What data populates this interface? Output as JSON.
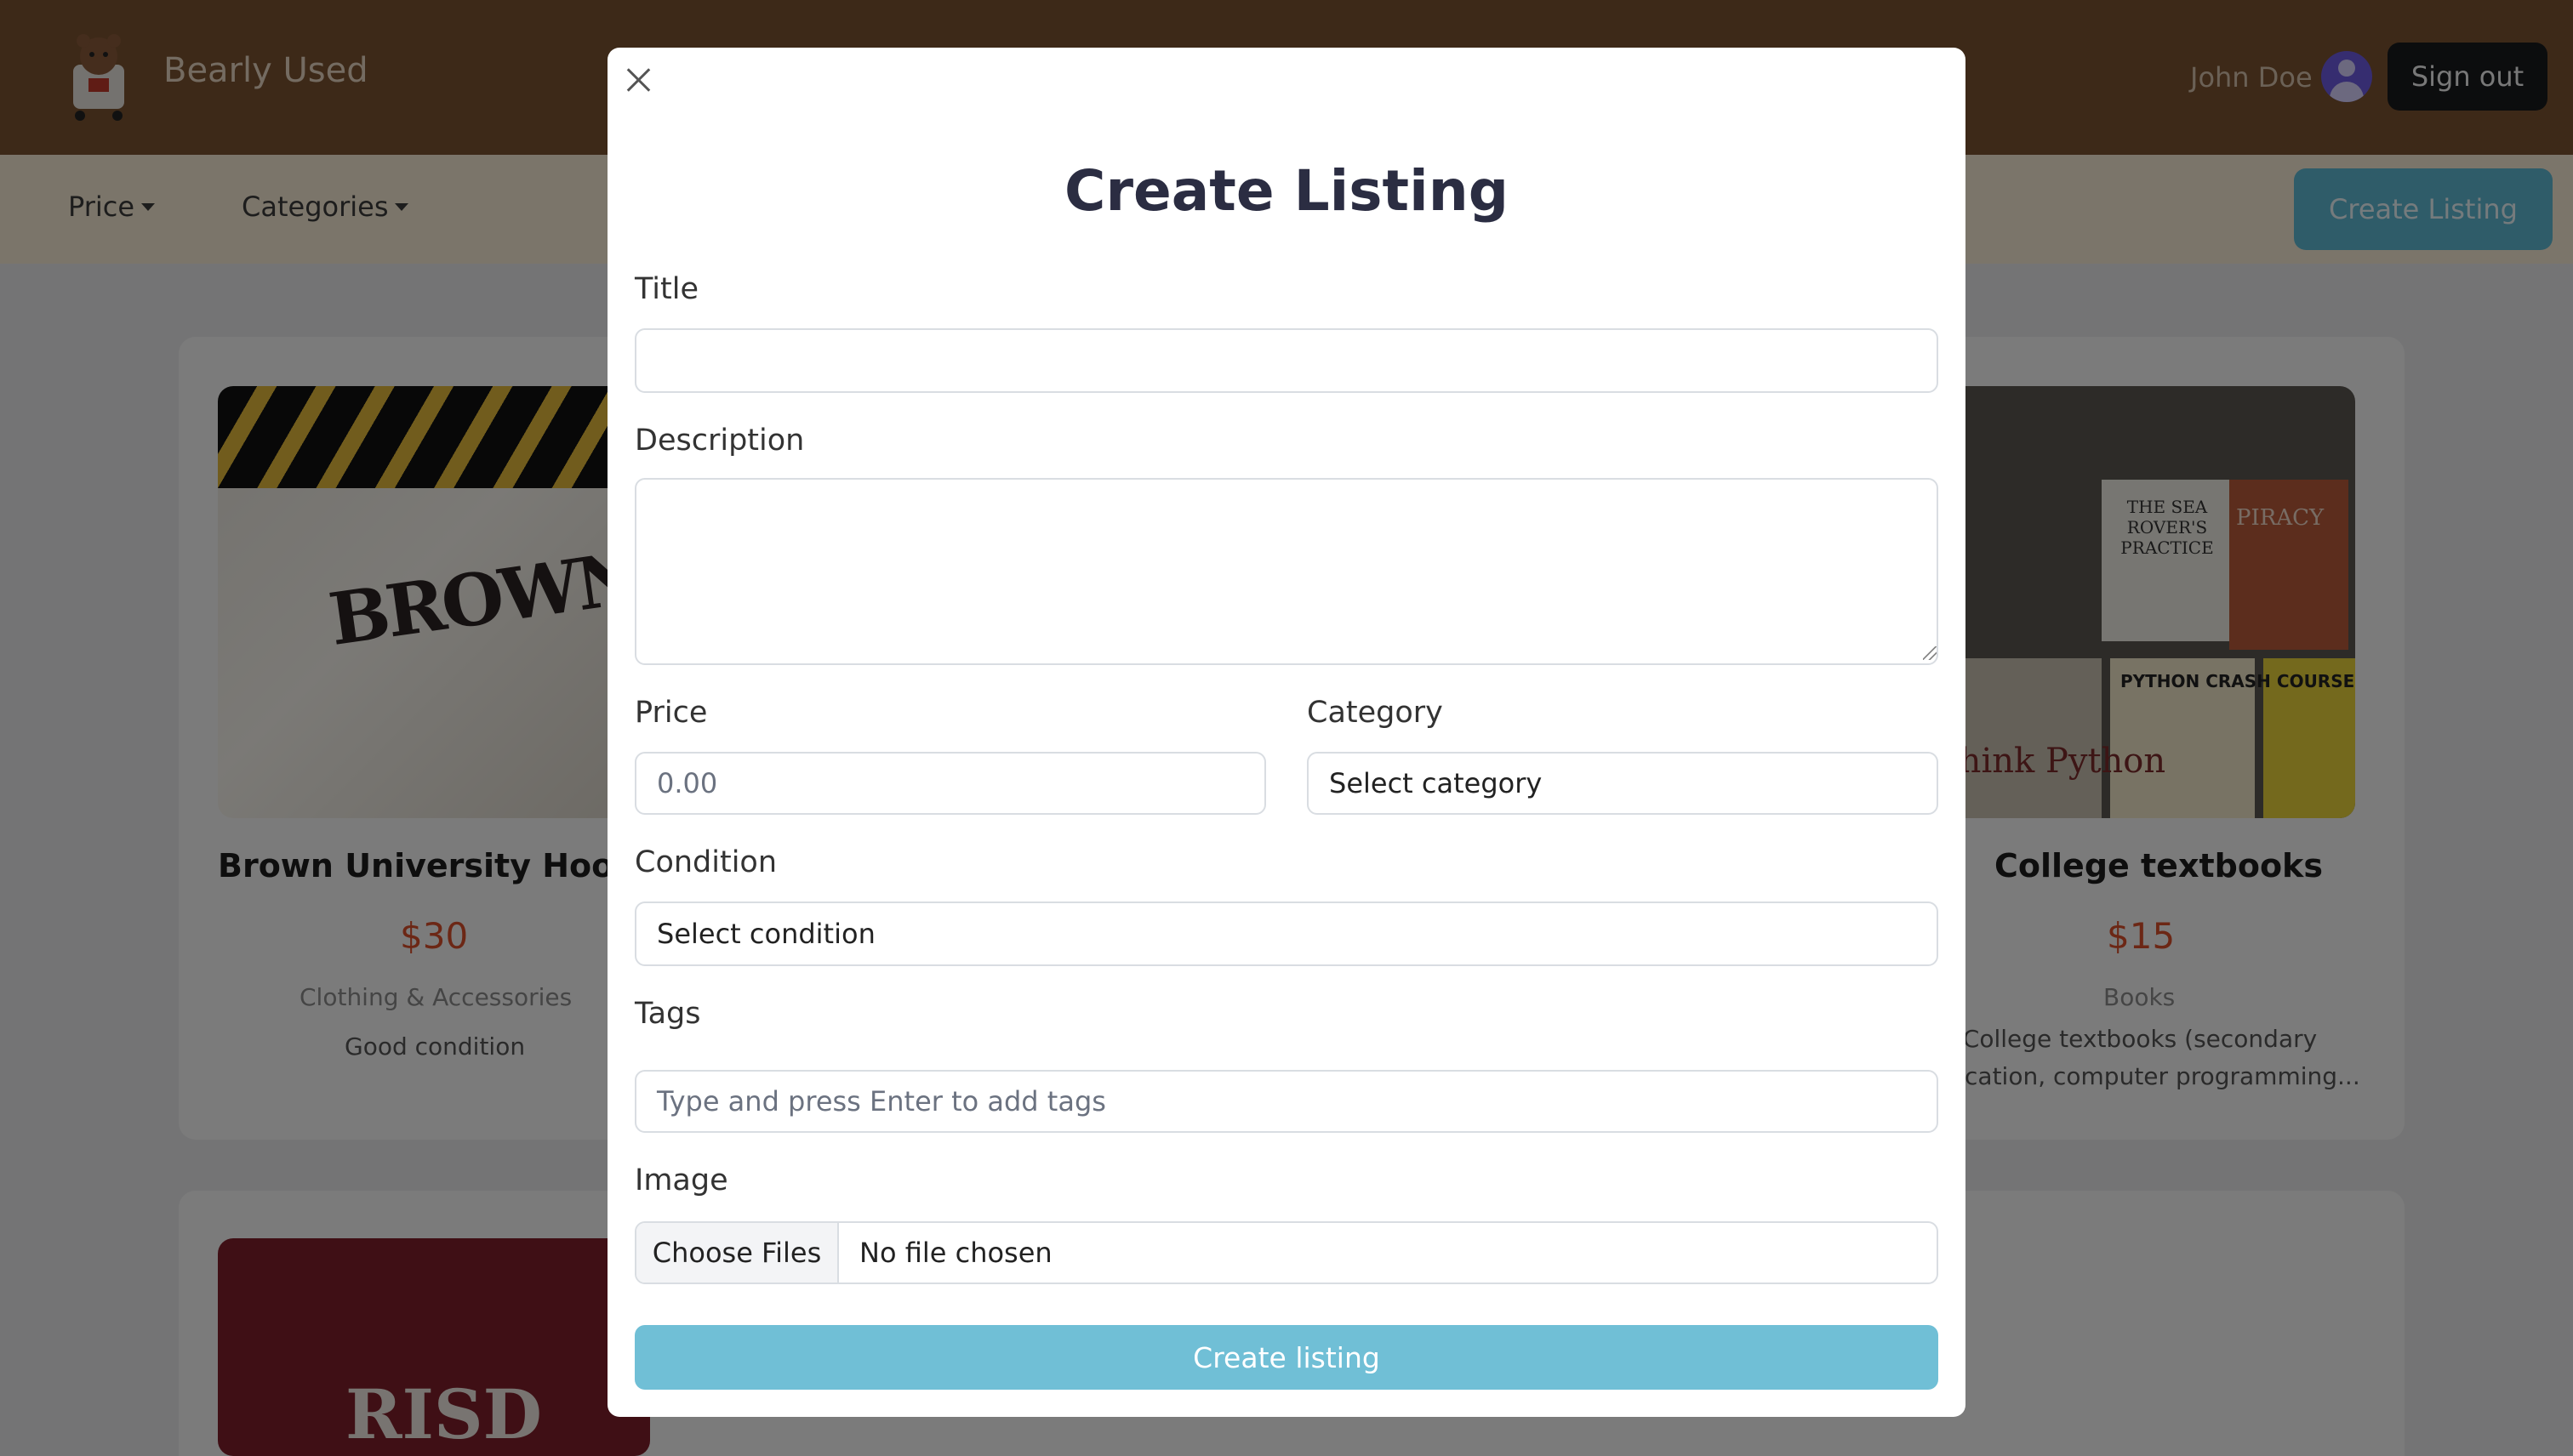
{
  "app": {
    "brand": "Bearly Used",
    "user_name": "John Doe",
    "signout_label": "Sign out"
  },
  "subnav": {
    "price_label": "Price",
    "categories_label": "Categories",
    "create_label": "Create Listing"
  },
  "listings": [
    {
      "title": "Brown University Hoodie",
      "price": "$30",
      "category": "Clothing & Accessories",
      "condition": "Good condition",
      "image_text": "BROWN"
    },
    {
      "title": "College textbooks",
      "price": "$15",
      "category": "Books",
      "description": "College textbooks (secondary education, computer programming...",
      "image_texts": [
        "THE SEA ROVER'S PRACTICE",
        "PIRACY",
        "Think Python",
        "PYTHON CRASH COURSE"
      ]
    },
    {
      "image_text": "RISD"
    }
  ],
  "modal": {
    "title": "Create Listing",
    "fields": {
      "title_label": "Title",
      "title_value": "",
      "description_label": "Description",
      "description_value": "",
      "price_label": "Price",
      "price_placeholder": "0.00",
      "category_label": "Category",
      "category_selected": "Select category",
      "condition_label": "Condition",
      "condition_selected": "Select condition",
      "tags_label": "Tags",
      "tags_placeholder": "Type and press Enter to add tags",
      "image_label": "Image",
      "file_button": "Choose Files",
      "file_status": "No file chosen"
    },
    "submit_label": "Create listing"
  },
  "colors": {
    "topbar": "#7a5230",
    "subnav": "#f6ead4",
    "accent": "#5fb8d3",
    "submit": "#70bfd6",
    "price": "#d94f2b",
    "title": "#2b2d42"
  },
  "icons": {
    "close": "close-icon",
    "caret": "caret-down-icon",
    "avatar": "user-avatar-icon"
  }
}
